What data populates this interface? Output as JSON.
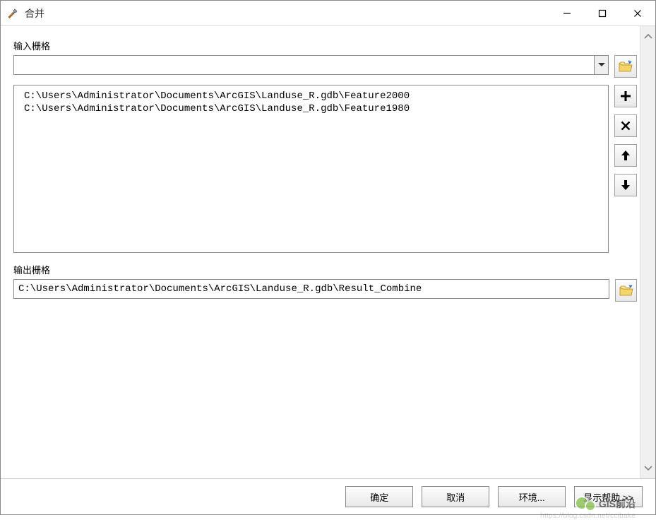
{
  "window": {
    "title": "合并"
  },
  "labels": {
    "input_raster": "输入栅格",
    "output_raster": "输出栅格"
  },
  "input_combo_value": "",
  "input_list": {
    "items": [
      {
        "path": "C:\\Users\\Administrator\\Documents\\ArcGIS\\Landuse_R.gdb\\Feature2000"
      },
      {
        "path": "C:\\Users\\Administrator\\Documents\\ArcGIS\\Landuse_R.gdb\\Feature1980"
      }
    ]
  },
  "output_value": "C:\\Users\\Administrator\\Documents\\ArcGIS\\Landuse_R.gdb\\Result_Combine",
  "buttons": {
    "ok": "确定",
    "cancel": "取消",
    "env": "环境...",
    "help": "显示帮助 >>"
  },
  "watermark": {
    "text": "GIS前沿",
    "sub": "https://blog.csdn.net/ccibake"
  }
}
